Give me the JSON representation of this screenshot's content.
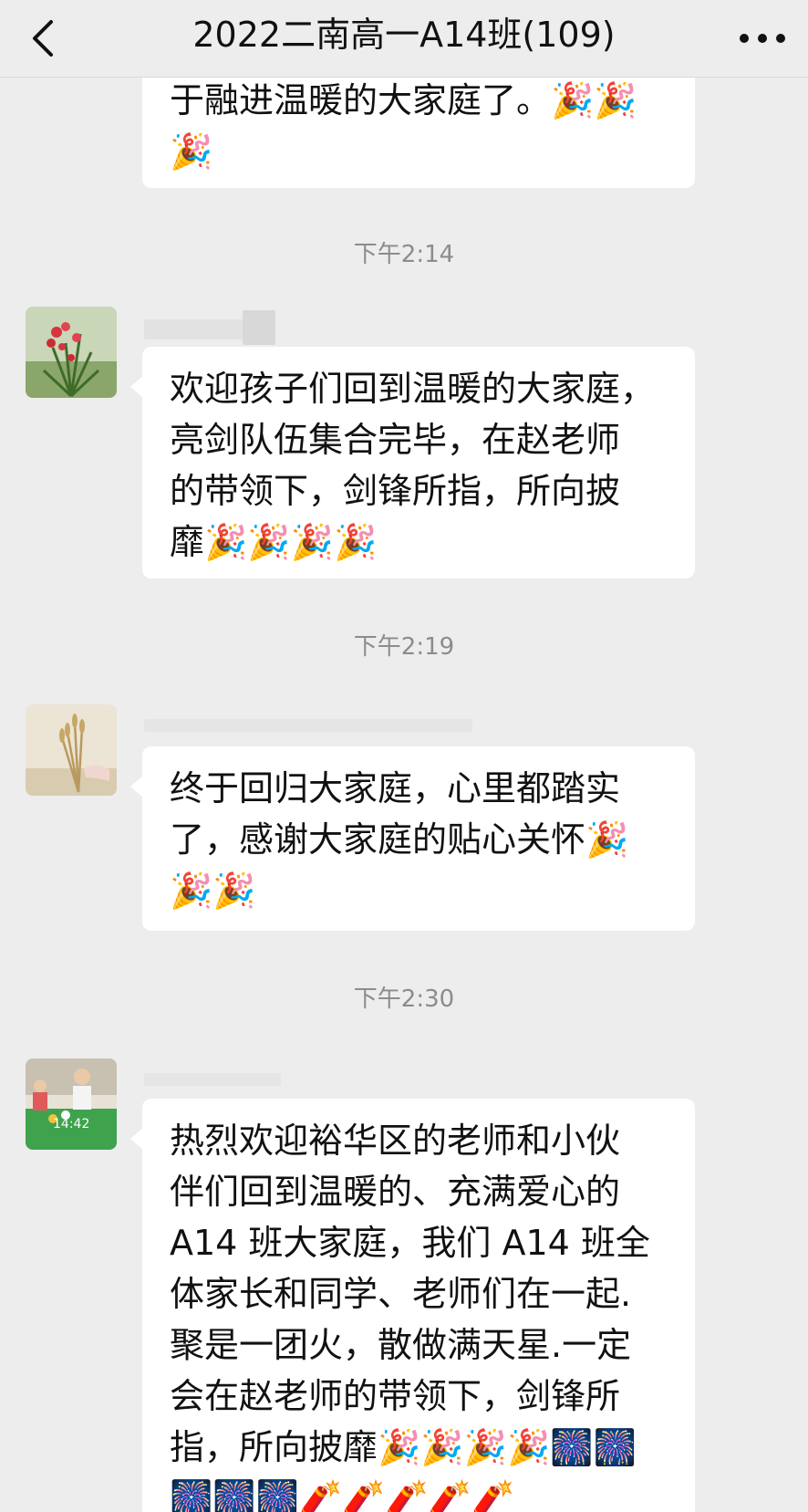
{
  "header": {
    "title": "2022二南高一A14班(109)",
    "back_icon": "chevron-left-icon",
    "more_icon": "more-dots-icon"
  },
  "messages": [
    {
      "lines": [
        "于融进温暖的大家庭了。🎉🎉",
        "🎉"
      ]
    },
    {
      "timestamp": "下午2:14",
      "avatar": "flower-avatar",
      "lines": [
        "欢迎孩子们回到温暖的大家庭，",
        "亮剑队伍集合完毕，在赵老师",
        "的带领下，剑锋所指，所向披",
        "靡🎉🎉🎉🎉"
      ]
    },
    {
      "timestamp": "下午2:19",
      "avatar": "wheat-avatar",
      "lines": [
        "终于回归大家庭，心里都踏实",
        "了，感谢大家庭的贴心关怀🎉",
        "🎉🎉"
      ]
    },
    {
      "timestamp": "下午2:30",
      "avatar": "kids-avatar",
      "avatar_text": "14:42",
      "lines": [
        "热烈欢迎裕华区的老师和小伙",
        "伴们回到温暖的、充满爱心的",
        "A14 班大家庭，我们 A14 班全",
        "体家长和同学、老师们在一起.",
        "聚是一团火，散做满天星.一定",
        "会在赵老师的带领下，剑锋所",
        "指，所向披靡🎉🎉🎉🎉🎆🎆",
        "🎆🎆🎆🧨🧨🧨🧨🧨"
      ]
    }
  ],
  "colors": {
    "background": "#ededed",
    "bubble": "#ffffff",
    "timestamp": "#8c8c8c"
  }
}
